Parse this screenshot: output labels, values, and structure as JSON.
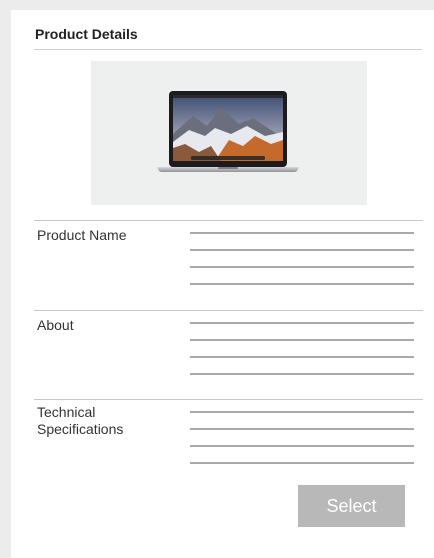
{
  "header": {
    "title": "Product Details"
  },
  "image": {
    "icon": "laptop-product-image"
  },
  "sections": [
    {
      "label": "Product Name"
    },
    {
      "label": "About"
    },
    {
      "label": "Technical\nSpecifications"
    }
  ],
  "actions": {
    "select_label": "Select"
  },
  "colors": {
    "button_bg": "#b8b8b8",
    "button_text": "#ffffff",
    "placeholder_line": "#a9a9a9",
    "divider": "#c8c8c8"
  }
}
